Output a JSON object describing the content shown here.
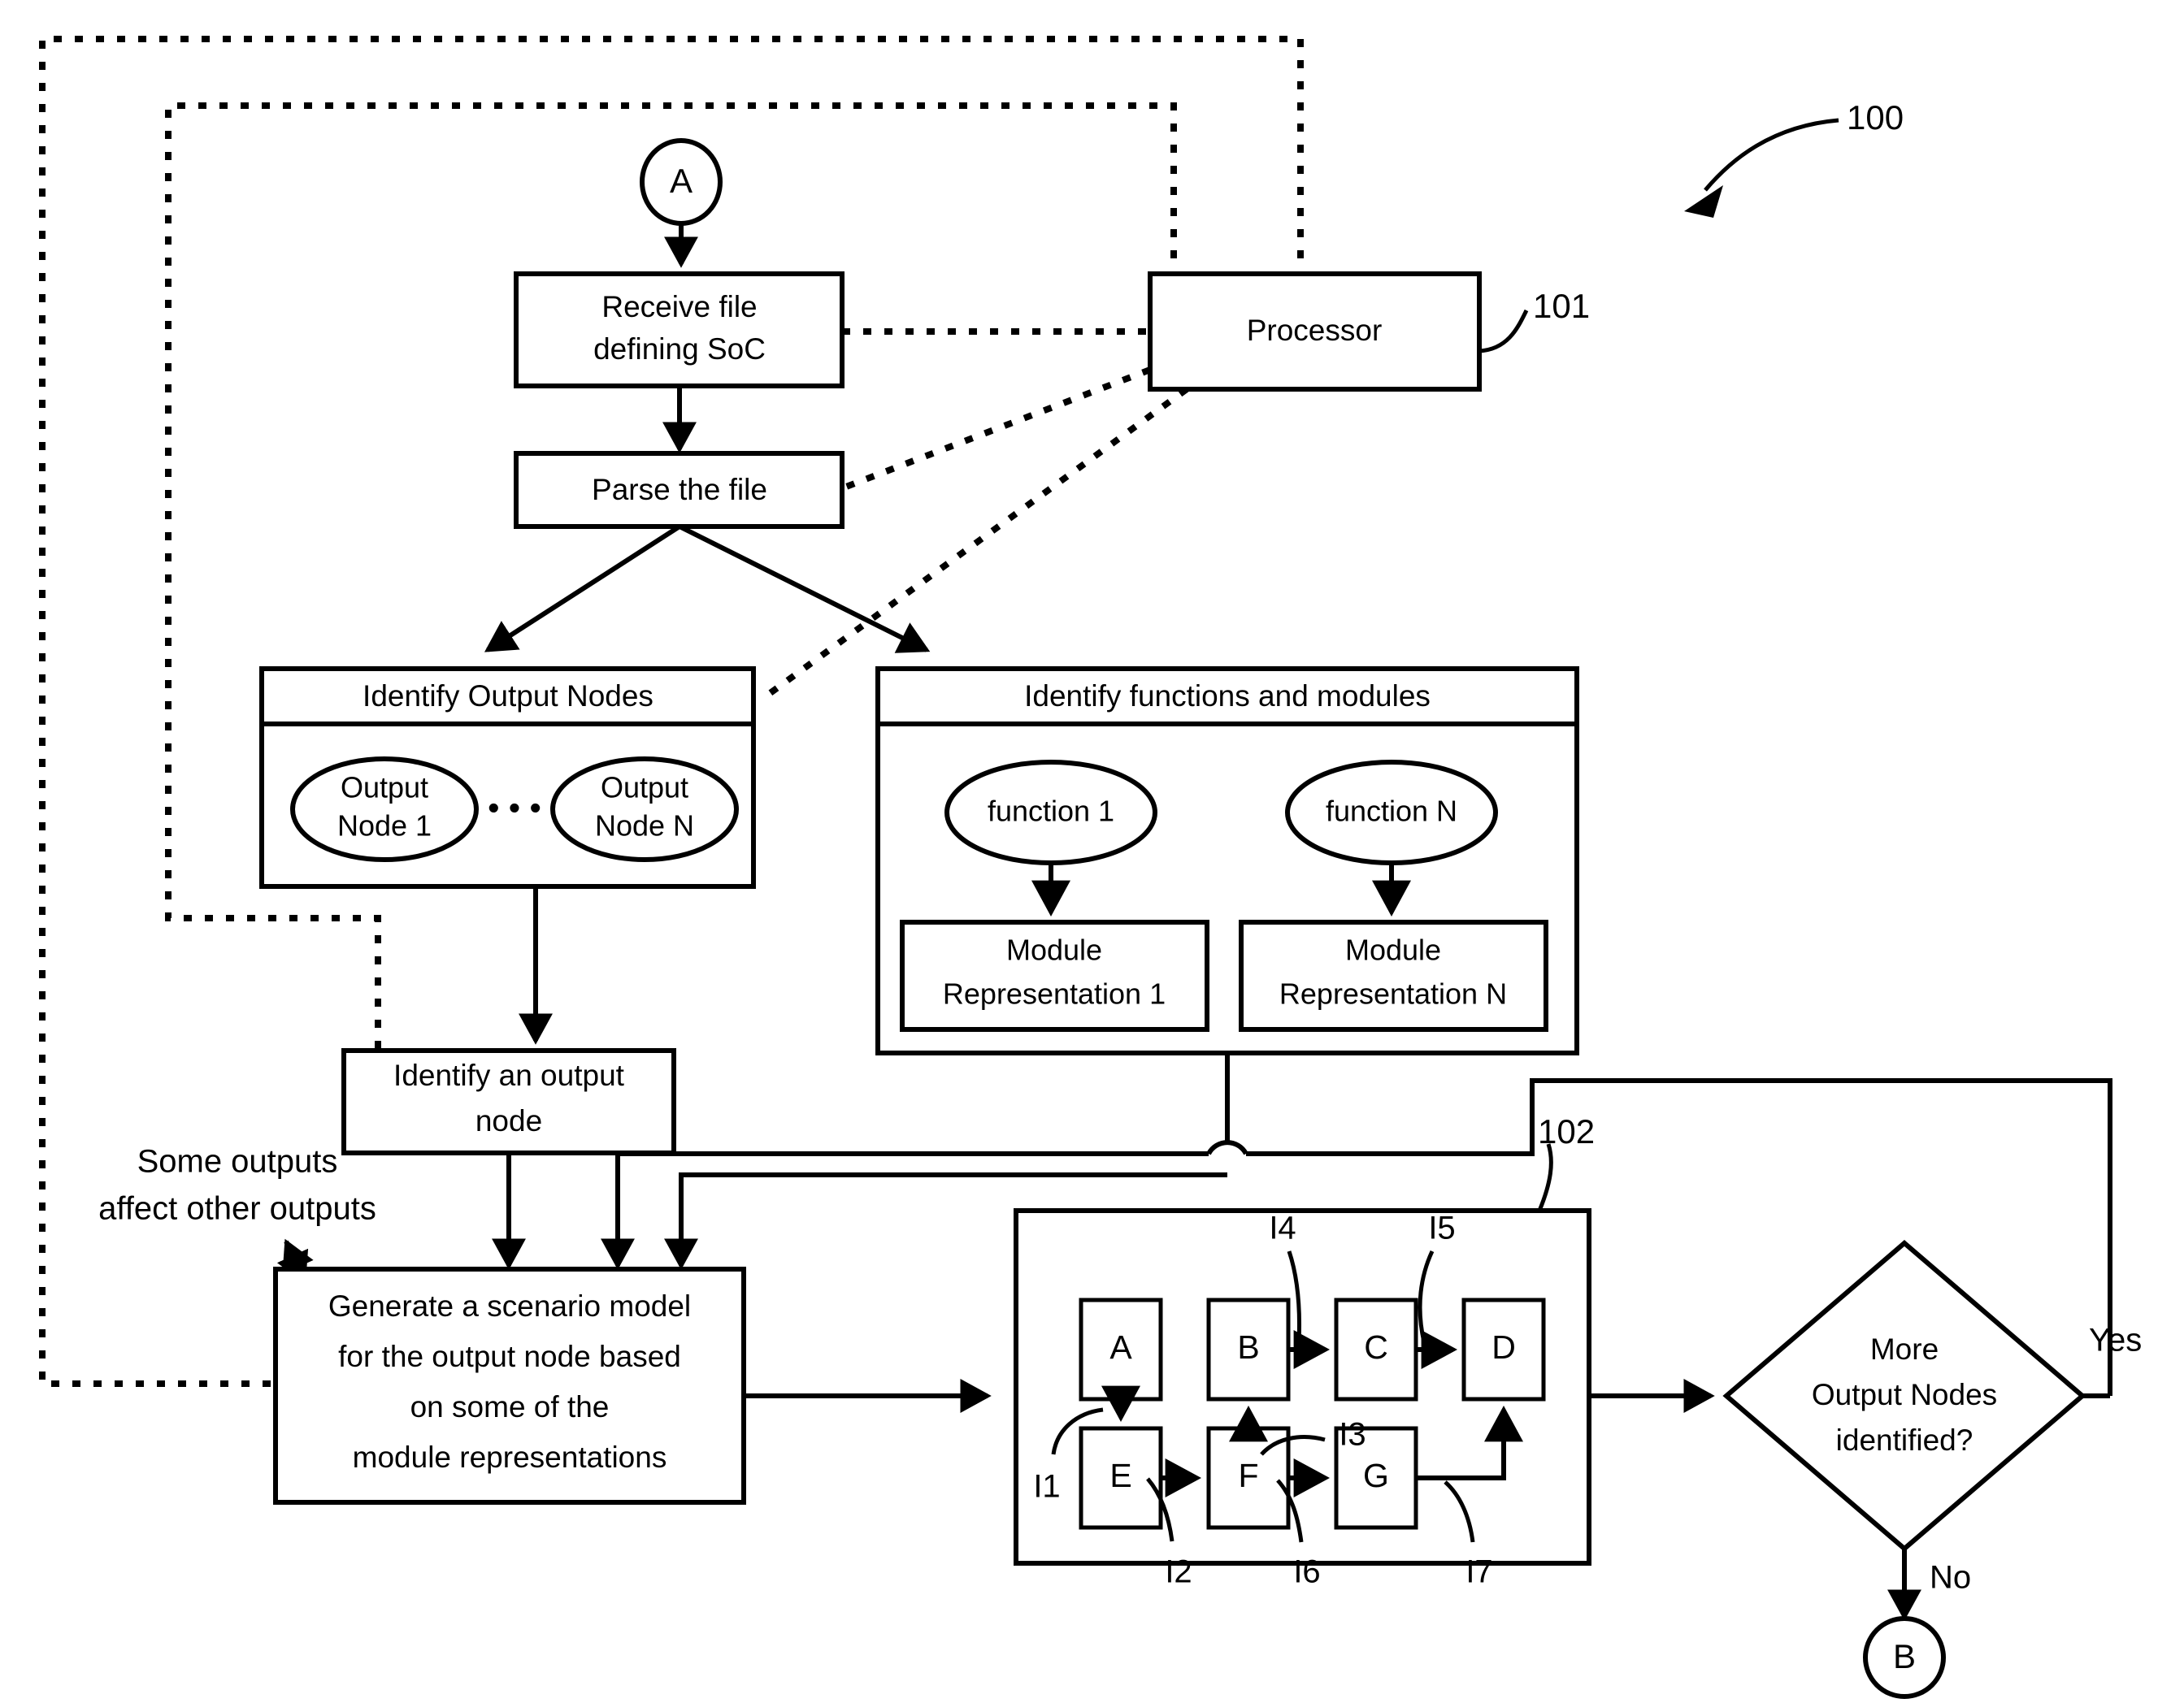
{
  "figure": {
    "ref_main": "100",
    "ref_processor": "101",
    "ref_scenario": "102"
  },
  "connectors": {
    "start": "A",
    "end": "B"
  },
  "boxes": {
    "receive_file_l1": "Receive file",
    "receive_file_l2": "defining SoC",
    "processor": "Processor",
    "parse_file": "Parse the file",
    "identify_output_nodes_title": "Identify Output Nodes",
    "output_node_1_l1": "Output",
    "output_node_1_l2": "Node 1",
    "output_node_n_l1": "Output",
    "output_node_n_l2": "Node N",
    "ellipsis": "• • •",
    "identify_functions_title": "Identify functions and modules",
    "function_1": "function 1",
    "function_n": "function N",
    "module_rep_1_l1": "Module",
    "module_rep_1_l2": "Representation 1",
    "module_rep_n_l1": "Module",
    "module_rep_n_l2": "Representation N",
    "identify_an_output_node_l1": "Identify an output",
    "identify_an_output_node_l2": "node",
    "generate_scenario_l1": "Generate a scenario model",
    "generate_scenario_l2": "for the output node based",
    "generate_scenario_l3": "on some of the",
    "generate_scenario_l4": "module representations"
  },
  "annotation": {
    "some_outputs_l1": "Some outputs",
    "some_outputs_l2": "affect other outputs"
  },
  "decision": {
    "line1": "More",
    "line2": "Output Nodes",
    "line3": "identified?",
    "yes_label": "Yes",
    "no_label": "No"
  },
  "scenario_graph": {
    "nodes": [
      "A",
      "B",
      "C",
      "D",
      "E",
      "F",
      "G"
    ],
    "inputs": [
      "I1",
      "I2",
      "I3",
      "I4",
      "I5",
      "I6",
      "I7"
    ]
  },
  "colors": {
    "stroke": "#000000",
    "fill": "#ffffff"
  }
}
